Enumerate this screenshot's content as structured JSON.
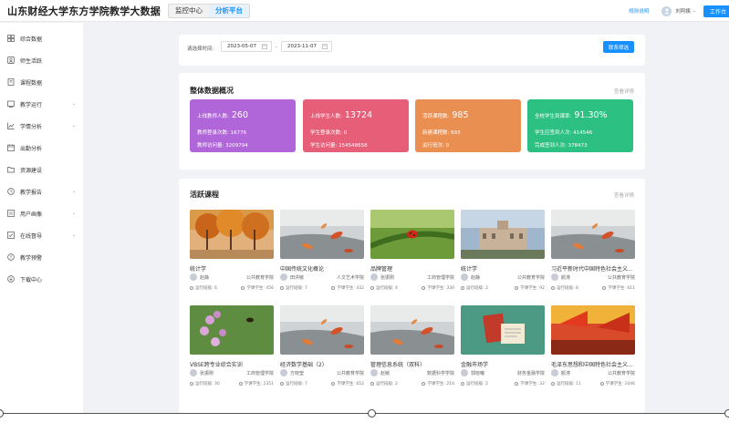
{
  "header": {
    "title": "山东财经大学东方学院教学大数据",
    "tabs": [
      {
        "label": "监控中心"
      },
      {
        "label": "分析平台"
      }
    ],
    "rules_link": "规则说明",
    "user_name": "刘阿姨",
    "workbench_label": "工作台"
  },
  "sidebar": {
    "items": [
      {
        "label": "综合数据",
        "icon": "grid-icon",
        "has_children": false
      },
      {
        "label": "师生活跃",
        "icon": "user-activity-icon",
        "has_children": false
      },
      {
        "label": "课程数据",
        "icon": "book-icon",
        "has_children": false
      },
      {
        "label": "教学运行",
        "icon": "run-icon",
        "has_children": true
      },
      {
        "label": "学情分析",
        "icon": "chart-icon",
        "has_children": true
      },
      {
        "label": "出勤分析",
        "icon": "calendar-icon",
        "has_children": false
      },
      {
        "label": "资源建设",
        "icon": "folder-icon",
        "has_children": false
      },
      {
        "label": "教学报告",
        "icon": "report-icon",
        "has_children": true
      },
      {
        "label": "用户画像",
        "icon": "profile-icon",
        "has_children": true
      },
      {
        "label": "在线督导",
        "icon": "monitor-icon",
        "has_children": true
      },
      {
        "label": "教学预警",
        "icon": "warning-icon",
        "has_children": false
      },
      {
        "label": "下载中心",
        "icon": "download-icon",
        "has_children": false
      }
    ]
  },
  "filter": {
    "label": "请选择时间:",
    "start_date": "2023-05-07",
    "end_date": "2023-11-07",
    "separator": "-",
    "button_label": "联系筛选"
  },
  "overview": {
    "title": "整体数据概况",
    "view_more": "查看详情",
    "boxes": [
      {
        "color": "#b066d9",
        "main_label": "上线教师人数:",
        "main_value": "260",
        "rows": [
          {
            "label": "教师登录次数:",
            "value": "16776"
          },
          {
            "label": "教师访问量:",
            "value": "3209794"
          }
        ]
      },
      {
        "color": "#e65e78",
        "main_label": "上线学生人数:",
        "main_value": "13724",
        "rows": [
          {
            "label": "学生登录次数:",
            "value": "0"
          },
          {
            "label": "学生访问量:",
            "value": "154548658"
          }
        ]
      },
      {
        "color": "#ea8f52",
        "main_label": "活跃课程数:",
        "main_value": "985",
        "rows": [
          {
            "label": "新建课程数:",
            "value": "693"
          },
          {
            "label": "运行班次:",
            "value": "0"
          }
        ]
      },
      {
        "color": "#2cc082",
        "main_label": "全校学生到课率:",
        "main_value": "91.30%",
        "rows": [
          {
            "label": "学生应签到人次:",
            "value": "414546"
          },
          {
            "label": "完成签到人次:",
            "value": "378473"
          }
        ]
      }
    ]
  },
  "courses": {
    "title": "活跃课程",
    "view_more": "查看详情",
    "run_label": "运行班级:",
    "student_label": "学课学生:",
    "items": [
      {
        "name": "统计学",
        "teacher": "赵静",
        "college": "公共教育学院",
        "classes": "6",
        "students": "456",
        "img": "autumn"
      },
      {
        "name": "中国传统文化概论",
        "teacher": "田洪敏",
        "college": "人文艺术学院",
        "classes": "7",
        "students": "432",
        "img": "leaves"
      },
      {
        "name": "品牌管理",
        "teacher": "张振刚",
        "college": "工商管理学院",
        "classes": "4",
        "students": "330",
        "img": "ladybug"
      },
      {
        "name": "统计学",
        "teacher": "赵静",
        "college": "公共教育学院",
        "classes": "2",
        "students": "92",
        "img": "building"
      },
      {
        "name": "习近平新时代中国特色社会主义...",
        "teacher": "颜涛",
        "college": "公共教育学院",
        "classes": "8",
        "students": "611",
        "img": "leaves"
      },
      {
        "name": "VBSE跨专业综合实训",
        "teacher": "张振刚",
        "college": "工商管理学院",
        "classes": "30",
        "students": "2351",
        "img": "flowers"
      },
      {
        "name": "经济数学基础（2）",
        "teacher": "方晓莹",
        "college": "公共教育学院",
        "classes": "7",
        "students": "652",
        "img": "leaves"
      },
      {
        "name": "管理信息系统（双科）",
        "teacher": "赵敏",
        "college": "数据科学学院",
        "classes": "2",
        "students": "214",
        "img": "leaves"
      },
      {
        "name": "金融市场学",
        "teacher": "郭晓曦",
        "college": "财务金融学院",
        "classes": "2",
        "students": "32",
        "img": "books"
      },
      {
        "name": "毛泽东思想和中国特色社会主义...",
        "teacher": "颜涛",
        "college": "公共教育学院",
        "classes": "11",
        "students": "1046",
        "img": "flags"
      }
    ]
  }
}
